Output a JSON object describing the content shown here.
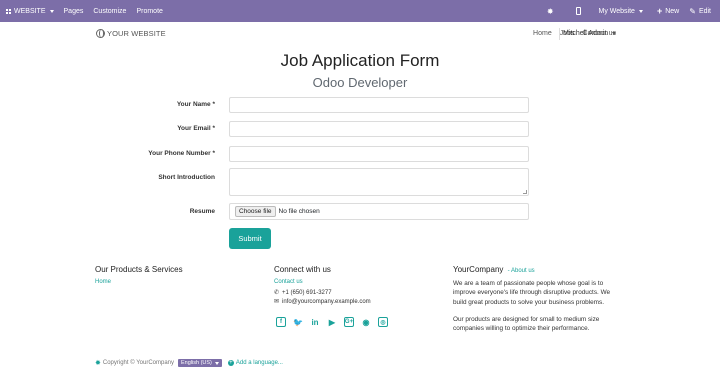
{
  "adminbar": {
    "website_label": "WEBSITE",
    "pages_label": "Pages",
    "customize_label": "Customize",
    "promote_label": "Promote",
    "my_website_label": "My Website",
    "new_label": "New",
    "edit_label": "Edit"
  },
  "nav": {
    "logo_text": "YOUR WEBSITE",
    "links": [
      "Home",
      "Jobs",
      "Contact us"
    ],
    "user_label": "Mitchell Admin"
  },
  "form": {
    "title": "Job Application Form",
    "subtitle": "Odoo Developer",
    "name_label": "Your Name *",
    "email_label": "Your Email *",
    "phone_label": "Your Phone Number *",
    "intro_label": "Short Introduction",
    "resume_label": "Resume",
    "choose_file_label": "Choose file",
    "no_file_text": "No file chosen",
    "submit_label": "Submit"
  },
  "footer": {
    "products_heading": "Our Products & Services",
    "products_link": "Home",
    "connect_heading": "Connect with us",
    "contact_link": "Contact us",
    "phone": "+1 (650) 691-3277",
    "email": "info@yourcompany.example.com",
    "social_icons": [
      "facebook-icon",
      "twitter-icon",
      "linkedin-icon",
      "youtube-icon",
      "google-plus-icon",
      "github-icon",
      "instagram-icon"
    ],
    "company_heading": "YourCompany",
    "about_link": "- About us",
    "about_p1": "We are a team of passionate people whose goal is to improve everyone's life through disruptive products. We build great products to solve your business problems.",
    "about_p2": "Our products are designed for small to medium size companies willing to optimize their performance.",
    "copyright": "Copyright © YourCompany",
    "language": "English (US)",
    "add_language": "Add a language..."
  },
  "colors": {
    "admin_bar": "#7c6ea8",
    "accent": "#1aa29a"
  }
}
